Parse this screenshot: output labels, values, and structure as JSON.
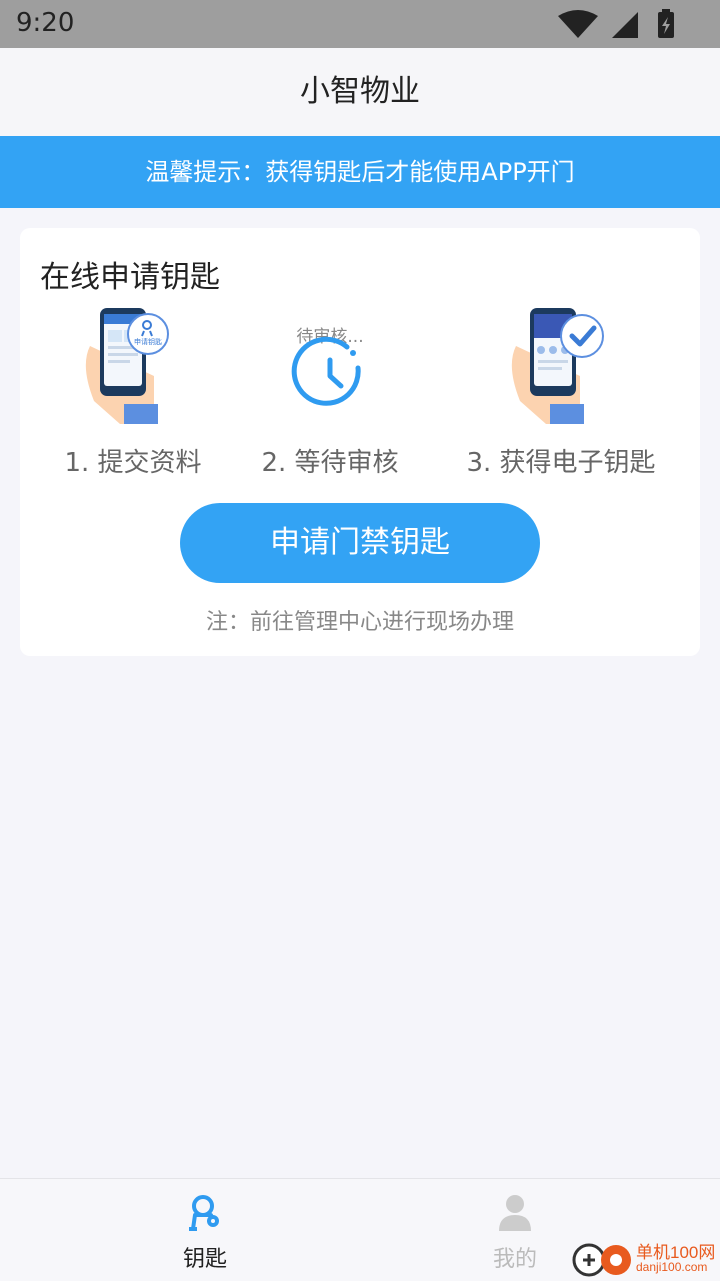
{
  "status_bar": {
    "time": "9:20"
  },
  "header": {
    "title": "小智物业"
  },
  "notice": {
    "text": "温馨提示：获得钥匙后才能使用APP开门"
  },
  "card": {
    "title": "在线申请钥匙",
    "steps": [
      {
        "label": "1. 提交资料",
        "icon": "phone-hand-apply-icon",
        "badge_text": "申请钥匙"
      },
      {
        "label": "2. 等待审核",
        "icon": "clock-icon",
        "status_text": "待审核..."
      },
      {
        "label": "3. 获得电子钥匙",
        "icon": "phone-hand-check-icon"
      }
    ],
    "button_label": "申请门禁钥匙",
    "note": "注：前往管理中心进行现场办理"
  },
  "tabs": [
    {
      "label": "钥匙",
      "icon": "key-icon",
      "active": true
    },
    {
      "label": "我的",
      "icon": "user-icon",
      "active": false
    }
  ],
  "watermark": {
    "line1": "单机100网",
    "line2": "danji100.com"
  },
  "colors": {
    "accent": "#33a3f4",
    "background": "#f5f5fa",
    "status_bar": "#9e9e9e",
    "tab_inactive": "#cccccc"
  }
}
